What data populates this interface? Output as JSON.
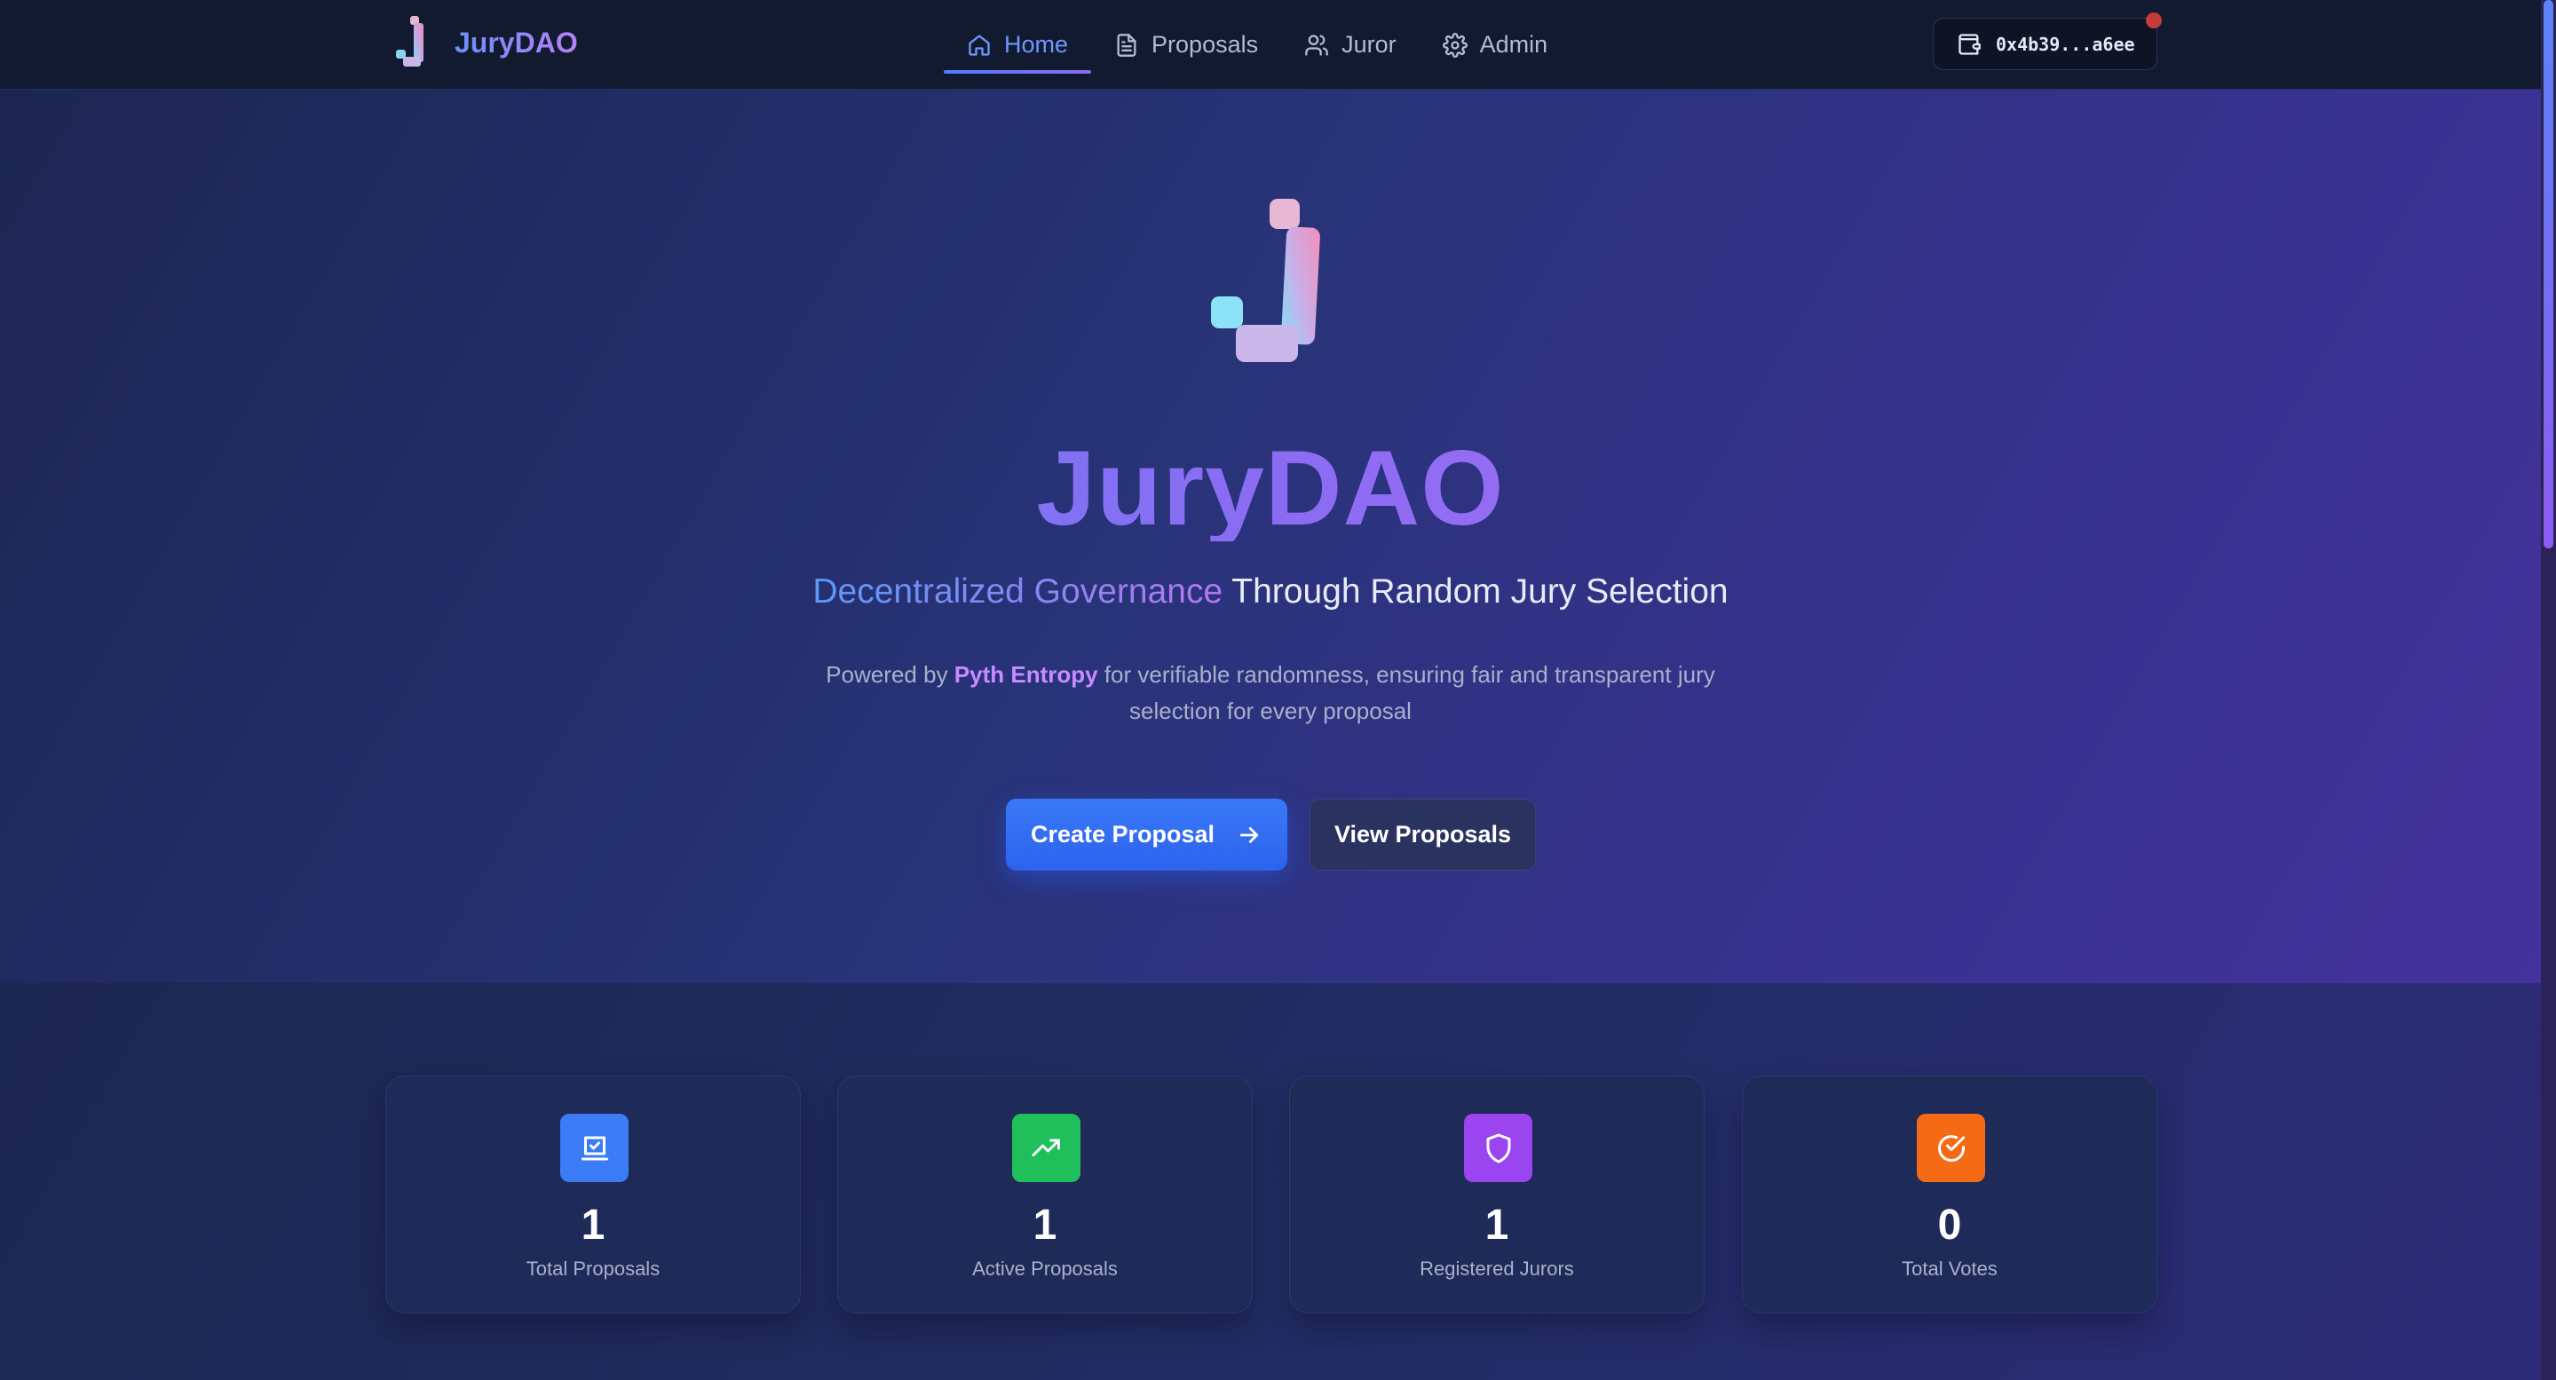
{
  "navbar": {
    "brand_name": "JuryDAO",
    "items": [
      {
        "label": "Home",
        "icon": "home-icon",
        "active": true
      },
      {
        "label": "Proposals",
        "icon": "document-icon",
        "active": false
      },
      {
        "label": "Juror",
        "icon": "users-icon",
        "active": false
      },
      {
        "label": "Admin",
        "icon": "gear-icon",
        "active": false
      }
    ],
    "wallet_address": "0x4b39...a6ee",
    "wallet_icon": "wallet-icon"
  },
  "hero": {
    "title": "JuryDAO",
    "subtitle_highlight": "Decentralized Governance",
    "subtitle_rest": " Through Random Jury Selection",
    "description_prefix": "Powered by ",
    "description_highlight": "Pyth Entropy",
    "description_suffix": " for verifiable randomness, ensuring fair and transparent jury selection for every proposal",
    "primary_button": "Create Proposal",
    "secondary_button": "View Proposals"
  },
  "stats": [
    {
      "value": "1",
      "label": "Total Proposals",
      "icon": "ballot-icon",
      "color": "#3b7cf6"
    },
    {
      "value": "1",
      "label": "Active Proposals",
      "icon": "trending-up-icon",
      "color": "#1fbf5a"
    },
    {
      "value": "1",
      "label": "Registered Jurors",
      "icon": "shield-icon",
      "color": "#9b45f0"
    },
    {
      "value": "0",
      "label": "Total Votes",
      "icon": "check-circle-icon",
      "color": "#f56a15"
    }
  ],
  "colors": {
    "navbar_bg": "#121a30",
    "accent_blue": "#2c63ec",
    "accent_purple": "#8a6cf3"
  }
}
